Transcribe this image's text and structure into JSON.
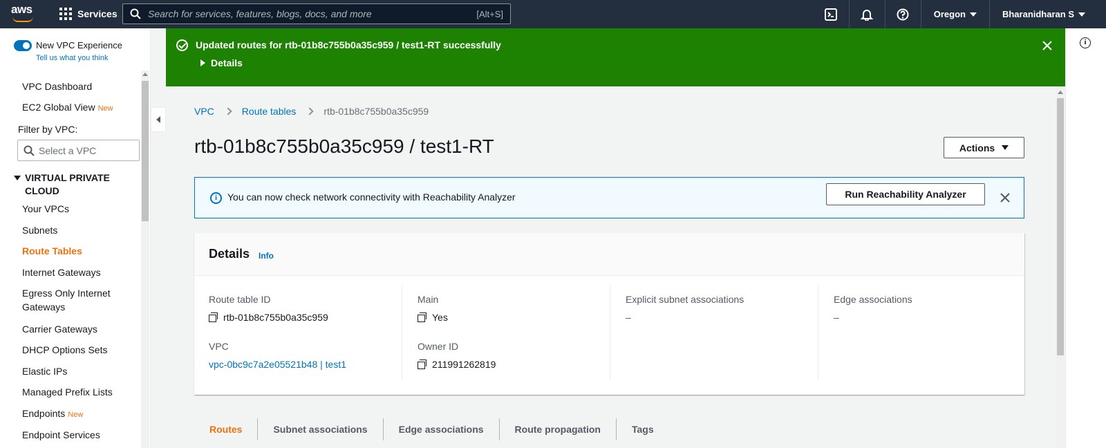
{
  "topnav": {
    "logo": "aws",
    "services_label": "Services",
    "search_placeholder": "Search for services, features, blogs, docs, and more",
    "search_shortcut": "[Alt+S]",
    "region": "Oregon",
    "user": "Bharanidharan S",
    "icons": [
      "cloudshell-icon",
      "bell-icon",
      "help-icon"
    ]
  },
  "sidebar": {
    "toggle_label": "New VPC Experience",
    "toggle_sub": "Tell us what you think",
    "top_items": [
      {
        "label": "VPC Dashboard"
      },
      {
        "label": "EC2 Global View",
        "badge": "New"
      }
    ],
    "filter_label": "Filter by VPC:",
    "filter_placeholder": "Select a VPC",
    "section": "VIRTUAL PRIVATE CLOUD",
    "items": [
      {
        "label": "Your VPCs"
      },
      {
        "label": "Subnets"
      },
      {
        "label": "Route Tables",
        "active": true
      },
      {
        "label": "Internet Gateways"
      },
      {
        "label": "Egress Only Internet Gateways"
      },
      {
        "label": "Carrier Gateways"
      },
      {
        "label": "DHCP Options Sets"
      },
      {
        "label": "Elastic IPs"
      },
      {
        "label": "Managed Prefix Lists"
      },
      {
        "label": "Endpoints",
        "badge": "New"
      },
      {
        "label": "Endpoint Services"
      }
    ]
  },
  "flash": {
    "message": "Updated routes for rtb-01b8c755b0a35c959 / test1-RT successfully",
    "details": "Details",
    "color": "#1d8102"
  },
  "breadcrumb": [
    "VPC",
    "Route tables",
    "rtb-01b8c755b0a35c959"
  ],
  "page_title": "rtb-01b8c755b0a35c959 / test1-RT",
  "actions_label": "Actions",
  "info_alert": {
    "text": "You can now check network connectivity with Reachability Analyzer",
    "button": "Run Reachability Analyzer"
  },
  "details": {
    "title": "Details",
    "info": "Info",
    "route_table_id_label": "Route table ID",
    "route_table_id": "rtb-01b8c755b0a35c959",
    "vpc_label": "VPC",
    "vpc": "vpc-0bc9c7a2e05521b48 | test1",
    "main_label": "Main",
    "main": "Yes",
    "owner_label": "Owner ID",
    "owner": "211991262819",
    "explicit_label": "Explicit subnet associations",
    "explicit": "–",
    "edge_label": "Edge associations",
    "edge": "–"
  },
  "tabs": [
    {
      "label": "Routes",
      "active": true
    },
    {
      "label": "Subnet associations"
    },
    {
      "label": "Edge associations"
    },
    {
      "label": "Route propagation"
    },
    {
      "label": "Tags"
    }
  ]
}
